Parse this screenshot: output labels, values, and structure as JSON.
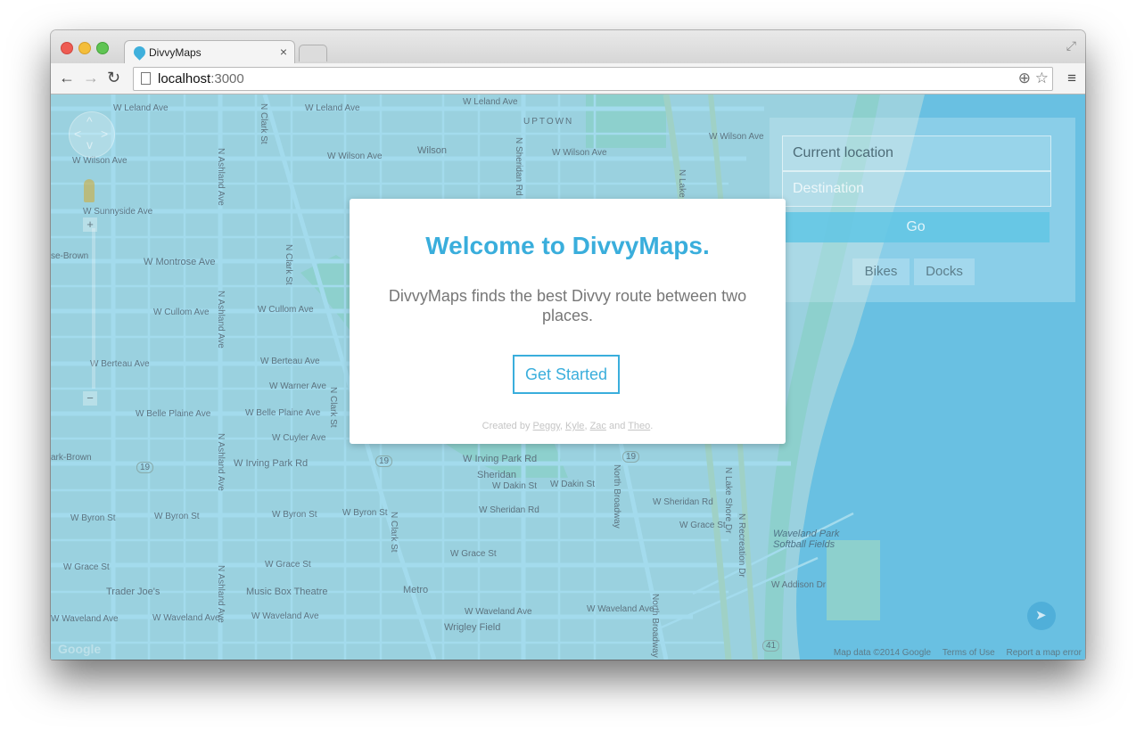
{
  "browser": {
    "tab_title": "DivvyMaps",
    "tab_close": "×",
    "url_host": "localhost",
    "url_port": ":3000",
    "nav_back": "←",
    "nav_forward": "→",
    "nav_reload": "↻",
    "omni_icons": "⊕ ☆",
    "menu": "≡",
    "fullscreen": "⤢"
  },
  "map": {
    "labels": [
      {
        "text": "W Leland Ave"
      },
      {
        "text": "W Leland Ave"
      },
      {
        "text": "W Leland Ave"
      },
      {
        "text": "UPTOWN"
      },
      {
        "text": "Wilson"
      },
      {
        "text": "W Wilson Ave"
      },
      {
        "text": "W Wilson Ave"
      },
      {
        "text": "W Wilson Ave"
      },
      {
        "text": "W Wilson Ave"
      },
      {
        "text": "W Sunnyside Ave"
      },
      {
        "text": "se-Brown"
      },
      {
        "text": "W Montrose Ave"
      },
      {
        "text": "W Cullom Ave"
      },
      {
        "text": "W Cullom Ave"
      },
      {
        "text": "W Berteau Ave"
      },
      {
        "text": "W Berteau Ave"
      },
      {
        "text": "W Warner Ave"
      },
      {
        "text": "W Belle Plaine Ave"
      },
      {
        "text": "W Belle Plaine Ave"
      },
      {
        "text": "W Cuyler Ave"
      },
      {
        "text": "ark-Brown"
      },
      {
        "text": "W Irving Park Rd"
      },
      {
        "text": "W Irving Park Rd"
      },
      {
        "text": "Sheridan"
      },
      {
        "text": "W Dakin St"
      },
      {
        "text": "W Dakin St"
      },
      {
        "text": "W Byron St"
      },
      {
        "text": "W Byron St"
      },
      {
        "text": "W Byron St"
      },
      {
        "text": "W Byron St"
      },
      {
        "text": "W Sheridan Rd"
      },
      {
        "text": "W Sheridan Rd"
      },
      {
        "text": "W Grace St"
      },
      {
        "text": "W Grace St"
      },
      {
        "text": "W Grace St"
      },
      {
        "text": "W Grace St"
      },
      {
        "text": "Trader Joe's"
      },
      {
        "text": "Music Box Theatre"
      },
      {
        "text": "Metro"
      },
      {
        "text": "W Waveland Ave"
      },
      {
        "text": "W Waveland Ave"
      },
      {
        "text": "W Waveland Ave"
      },
      {
        "text": "W Waveland Ave"
      },
      {
        "text": "W Waveland Ave"
      },
      {
        "text": "Wrigley Field"
      },
      {
        "text": "Waveland Park"
      },
      {
        "text": "Softball Fields"
      },
      {
        "text": "W Addison Dr"
      },
      {
        "text": "N Clark St"
      },
      {
        "text": "N Clark St"
      },
      {
        "text": "N Clark St"
      },
      {
        "text": "N Clark St"
      },
      {
        "text": "N Ashland Ave"
      },
      {
        "text": "N Ashland Ave"
      },
      {
        "text": "N Ashland Ave"
      },
      {
        "text": "N Ashland Ave"
      },
      {
        "text": "N Sheridan Rd"
      },
      {
        "text": "North Broadway"
      },
      {
        "text": "North Broadway"
      },
      {
        "text": "N Lake Shore Dr"
      },
      {
        "text": "N Lake Shore Dr"
      },
      {
        "text": "N Recreation Dr"
      },
      {
        "text": "19"
      },
      {
        "text": "19"
      },
      {
        "text": "19"
      },
      {
        "text": "41"
      }
    ],
    "footer": [
      "Map data ©2014 Google",
      "Terms of Use",
      "Report a map error"
    ],
    "logo": "Google"
  },
  "sidepanel": {
    "current_location": "Current location",
    "destination": "Destination",
    "go": "Go",
    "bikes": "Bikes",
    "docks": "Docks"
  },
  "modal": {
    "title": "Welcome to DivvyMaps.",
    "body": "DivvyMaps finds the best Divvy route between two places.",
    "cta": "Get Started",
    "credits_prefix": "Created by",
    "authors": [
      "Peggy",
      "Kyle",
      "Zac",
      "Theo"
    ],
    "sep1": ",",
    "sep2": ",",
    "and": "and",
    "end": "."
  },
  "colors": {
    "accent": "#3aaedc",
    "lake": "#7fc4e6",
    "overlay": "#58bede"
  }
}
